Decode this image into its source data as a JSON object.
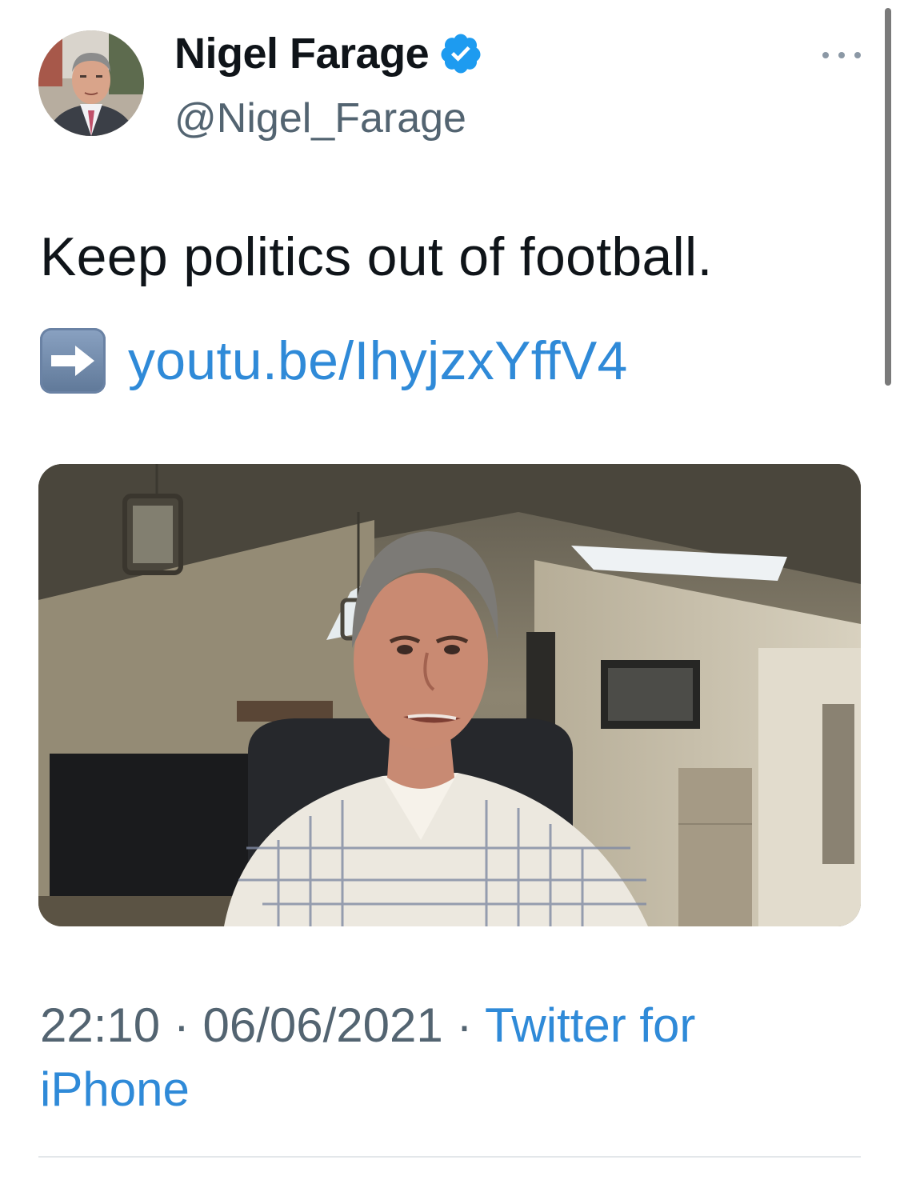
{
  "tweet": {
    "author": {
      "name": "Nigel Farage",
      "handle": "@Nigel_Farage",
      "verified": true,
      "avatar_icon": "profile-photo"
    },
    "text": "Keep politics out of football.",
    "link": {
      "emoji": "right-arrow-emoji",
      "text": "youtu.be/IhyjzxYffV4"
    },
    "media": {
      "type": "video-thumbnail"
    },
    "meta": {
      "time": "22:10",
      "separator": "·",
      "date": "06/06/2021",
      "source": "Twitter for iPhone"
    }
  },
  "colors": {
    "text": "#0f1419",
    "secondary": "#536471",
    "link": "#2f8ad8",
    "verified_badge": "#1d9bf0",
    "divider": "#e3e7ea"
  }
}
